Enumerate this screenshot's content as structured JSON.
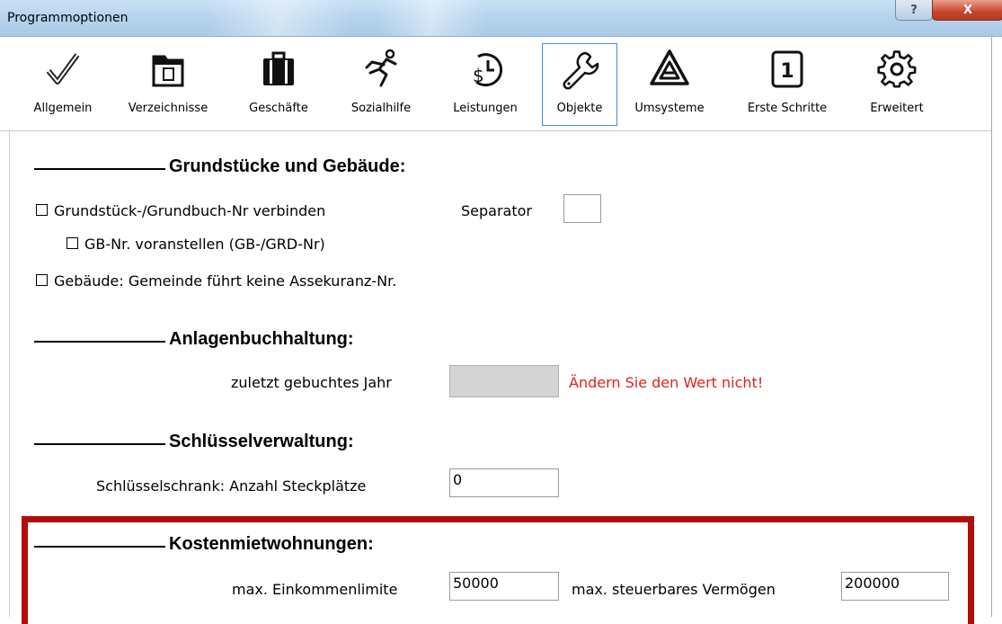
{
  "window": {
    "title": "Programmoptionen",
    "help_label": "?",
    "close_label": "X"
  },
  "toolbar": {
    "items": [
      {
        "label": "Allgemein",
        "icon": "checkmark-icon"
      },
      {
        "label": "Verzeichnisse",
        "icon": "folder-icon"
      },
      {
        "label": "Geschäfte",
        "icon": "briefcase-icon"
      },
      {
        "label": "Sozialhilfe",
        "icon": "walking-person-icon"
      },
      {
        "label": "Leistungen",
        "icon": "money-clock-icon"
      },
      {
        "label": "Objekte",
        "icon": "wrench-icon",
        "active": true
      },
      {
        "label": "Umsysteme",
        "icon": "triangle-logo-icon"
      },
      {
        "label": "Erste Schritte",
        "icon": "number-one-icon",
        "icon_text": "1"
      },
      {
        "label": "Erweitert",
        "icon": "gear-icon"
      }
    ]
  },
  "grundstuecke": {
    "heading": "Grundstücke und Gebäude:",
    "verbinden_label": "Grundstück-/Grundbuch-Nr verbinden",
    "separator_label": "Separator",
    "separator_value": "",
    "voranstellen_label": "GB-Nr. voranstellen (GB-/GRD-Nr)",
    "assekuranz_label": "Gebäude: Gemeinde führt keine Assekuranz-Nr."
  },
  "anlagen": {
    "heading": "Anlagenbuchhaltung:",
    "jahr_label": "zuletzt gebuchtes Jahr",
    "jahr_value": "",
    "warning": "Ändern Sie den Wert nicht!"
  },
  "schluessel": {
    "heading": "Schlüsselverwaltung:",
    "steckplaetze_label": "Schlüsselschrank: Anzahl Steckplätze",
    "steckplaetze_value": "0"
  },
  "kosten": {
    "heading": "Kostenmietwohnungen:",
    "einkommen_label": "max. Einkommenlimite",
    "einkommen_value": "50000",
    "vermoegen_label": "max. steuerbares Vermögen",
    "vermoegen_value": "200000"
  },
  "colors": {
    "active_border": "#3a8ee6",
    "warning": "#e02020",
    "highlight_box": "#b30d0d"
  }
}
